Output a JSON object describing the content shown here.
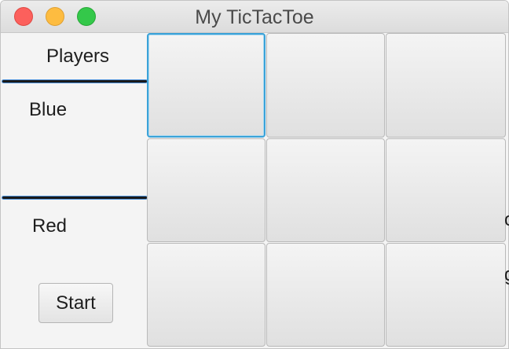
{
  "window": {
    "title": "My TicTacToe"
  },
  "sidebar": {
    "players_label": "Players",
    "player_one": "Blue",
    "player_two": "Red",
    "start_label": "Start"
  },
  "board": {
    "cells": [
      [
        "",
        "",
        ""
      ],
      [
        "",
        "",
        ""
      ],
      [
        "",
        "",
        ""
      ]
    ],
    "focused_cell": "row 1, column 1"
  },
  "clipped_text": {
    "right_edge_1": "o",
    "right_edge_2": "g"
  }
}
